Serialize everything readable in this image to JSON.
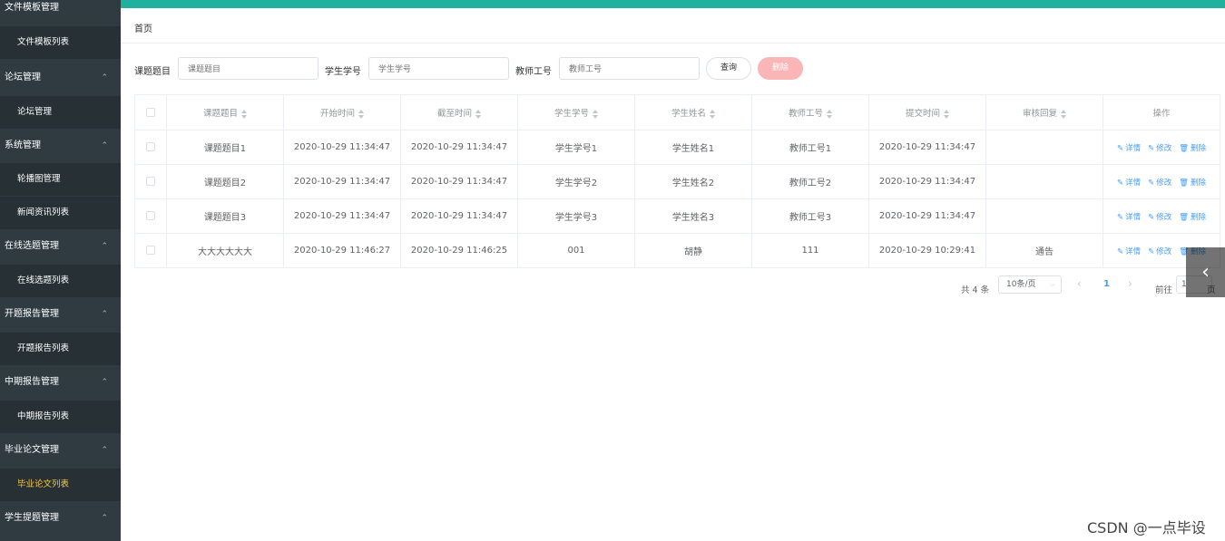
{
  "sidebar": {
    "partial_top_label": "文件模板管理",
    "items": [
      {
        "type": "sub",
        "label": "文件模板列表"
      },
      {
        "type": "menu",
        "label": "论坛管理"
      },
      {
        "type": "sub",
        "label": "论坛管理"
      },
      {
        "type": "menu",
        "label": "系统管理"
      },
      {
        "type": "sub",
        "label": "轮播图管理"
      },
      {
        "type": "sub",
        "label": "新闻资讯列表"
      },
      {
        "type": "menu",
        "label": "在线选题管理"
      },
      {
        "type": "sub",
        "label": "在线选题列表"
      },
      {
        "type": "menu",
        "label": "开题报告管理"
      },
      {
        "type": "sub",
        "label": "开题报告列表"
      },
      {
        "type": "menu",
        "label": "中期报告管理"
      },
      {
        "type": "sub",
        "label": "中期报告列表"
      },
      {
        "type": "menu",
        "label": "毕业论文管理"
      },
      {
        "type": "sub",
        "label": "毕业论文列表",
        "active": true
      },
      {
        "type": "menu",
        "label": "学生提题管理"
      }
    ]
  },
  "breadcrumb": "首页",
  "filters": {
    "topic_label": "课题题目",
    "topic_placeholder": "课题题目",
    "student_no_label": "学生学号",
    "student_no_placeholder": "学生学号",
    "teacher_no_label": "教师工号",
    "teacher_no_placeholder": "教师工号",
    "query_button": "查询",
    "delete_button": "删除"
  },
  "table": {
    "columns": [
      "课题题目",
      "开始时间",
      "截至时间",
      "学生学号",
      "学生姓名",
      "教师工号",
      "提交时间",
      "审核回复",
      "操作"
    ],
    "rows": [
      [
        "课题题目1",
        "2020-10-29 11:34:47",
        "2020-10-29 11:34:47",
        "学生学号1",
        "学生姓名1",
        "教师工号1",
        "2020-10-29 11:34:47",
        ""
      ],
      [
        "课题题目2",
        "2020-10-29 11:34:47",
        "2020-10-29 11:34:47",
        "学生学号2",
        "学生姓名2",
        "教师工号2",
        "2020-10-29 11:34:47",
        ""
      ],
      [
        "课题题目3",
        "2020-10-29 11:34:47",
        "2020-10-29 11:34:47",
        "学生学号3",
        "学生姓名3",
        "教师工号3",
        "2020-10-29 11:34:47",
        ""
      ],
      [
        "大大大大大大",
        "2020-10-29 11:46:27",
        "2020-10-29 11:46:25",
        "001",
        "胡静",
        "111",
        "2020-10-29 10:29:41",
        "通告"
      ]
    ],
    "actions": {
      "detail": "详情",
      "edit": "修改",
      "delete": "删除"
    }
  },
  "pagination": {
    "total": "共 4 条",
    "page_size": "10条/页",
    "current_page": "1",
    "goto_label": "前往",
    "goto_value": "1",
    "goto_suffix": "页"
  },
  "watermark": "CSDN @一点毕设",
  "colors": {
    "topbar": "#1fb19e",
    "sidebar": "#2f3a41",
    "active_menu": "#f7c744",
    "link": "#409eff"
  }
}
